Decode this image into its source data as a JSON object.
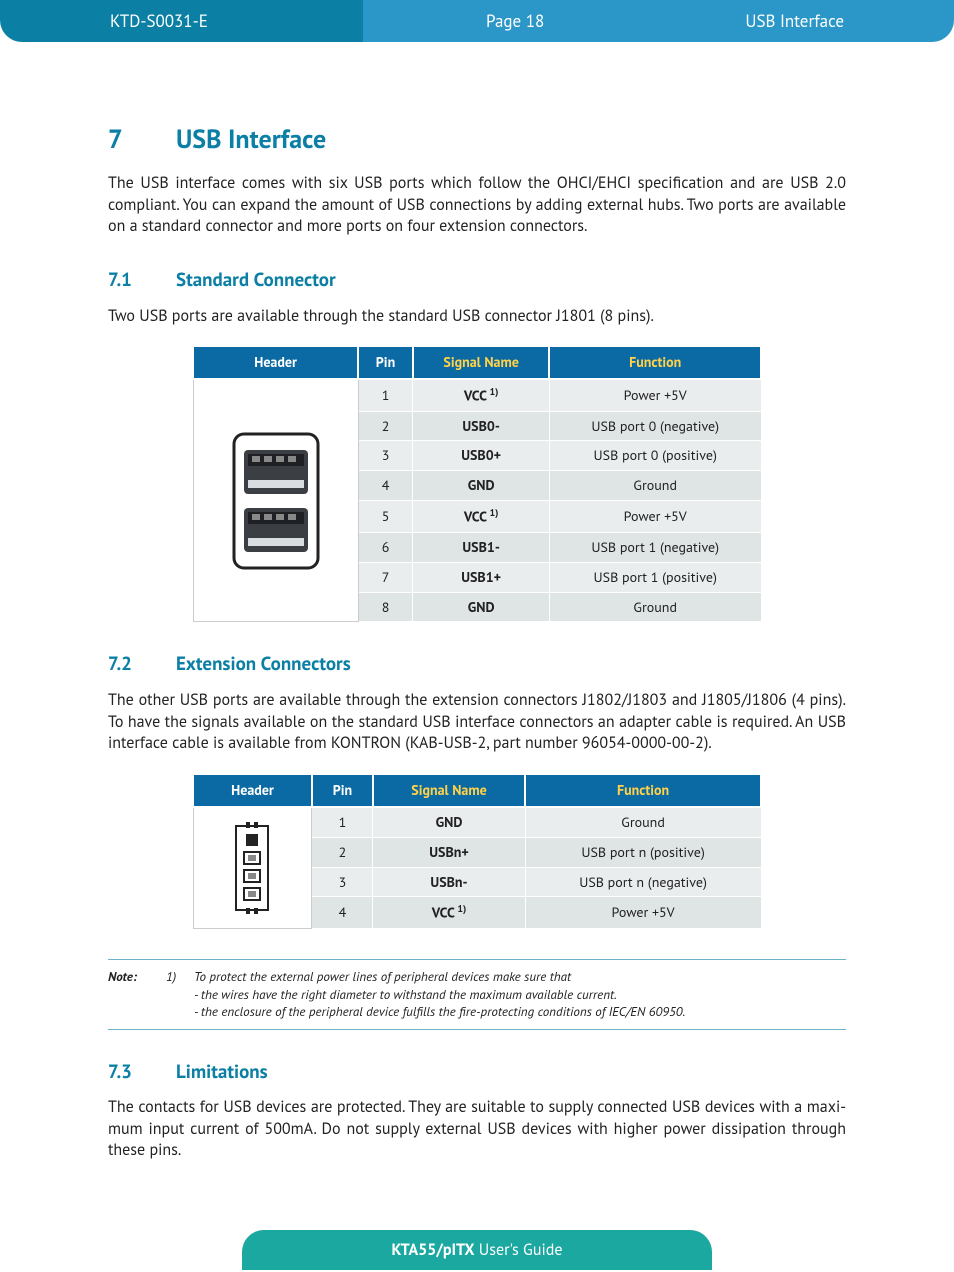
{
  "header": {
    "doc_id": "KTD-S0031-E",
    "page_label": "Page 18",
    "section": "USB Interface"
  },
  "chapter": {
    "num": "7",
    "title": "USB Interface"
  },
  "intro_para": "The USB interface comes with six USB ports which follow the OHCI/EHCI specification and are USB 2.0 compliant. You can expand the amount of USB connections by adding external hubs. Two ports are avail­able on a standard connector and more ports on four extension connectors.",
  "sections": {
    "s71": {
      "num": "7.1",
      "title": "Standard Connector",
      "para": "Two USB ports are available through the standard USB connector J1801 (8 pins)."
    },
    "s72": {
      "num": "7.2",
      "title": "Extension Connectors",
      "para": "The other USB ports are available through the extension connectors J1802/J1803 and J1805/J1806 (4 pins). To have the signals available on the standard USB interface connectors an adapter cable is required. An USB interface cable is available from KONTRON (KAB-USB-2, part number 96054-0000-00-2)."
    },
    "s73": {
      "num": "7.3",
      "title": "Limitations",
      "para": "The contacts for USB devices are protected. They are suitable to supply connected USB devices with a maxi­mum input current of 500mA. Do not supply external USB devices with higher power dissipation through these pins."
    }
  },
  "table_headers": {
    "h1": "Header",
    "h2": "Pin",
    "h3": "Signal Name",
    "h4": "Function"
  },
  "table1_rows": [
    {
      "pin": "1",
      "sig": "VCC",
      "sup": "1)",
      "func": "Power +5V"
    },
    {
      "pin": "2",
      "sig": "USB0-",
      "sup": "",
      "func": "USB port 0 (negative)"
    },
    {
      "pin": "3",
      "sig": "USB0+",
      "sup": "",
      "func": "USB port 0 (positive)"
    },
    {
      "pin": "4",
      "sig": "GND",
      "sup": "",
      "func": "Ground"
    },
    {
      "pin": "5",
      "sig": "VCC",
      "sup": "1)",
      "func": "Power +5V"
    },
    {
      "pin": "6",
      "sig": "USB1-",
      "sup": "",
      "func": "USB port 1 (negative)"
    },
    {
      "pin": "7",
      "sig": "USB1+",
      "sup": "",
      "func": "USB port 1 (positive)"
    },
    {
      "pin": "8",
      "sig": "GND",
      "sup": "",
      "func": "Ground"
    }
  ],
  "table2_rows": [
    {
      "pin": "1",
      "sig": "GND",
      "sup": "",
      "func": "Ground"
    },
    {
      "pin": "2",
      "sig": "USBn+",
      "sup": "",
      "func": "USB port n (positive)"
    },
    {
      "pin": "3",
      "sig": "USBn-",
      "sup": "",
      "func": "USB port n (negative)"
    },
    {
      "pin": "4",
      "sig": "VCC",
      "sup": "1)",
      "func": "Power +5V"
    }
  ],
  "note": {
    "label": "Note:",
    "ref": "1)",
    "line1": "To protect the external power lines of peripheral devices make sure that",
    "line2": "- the wires have the right diameter to withstand the maximum available current.",
    "line3": "- the enclosure of the peripheral device fulfills the fire-protecting conditions of IEC/EN 60950."
  },
  "footer": {
    "bold": "KTA55/pITX",
    "rest": " User's Guide"
  }
}
